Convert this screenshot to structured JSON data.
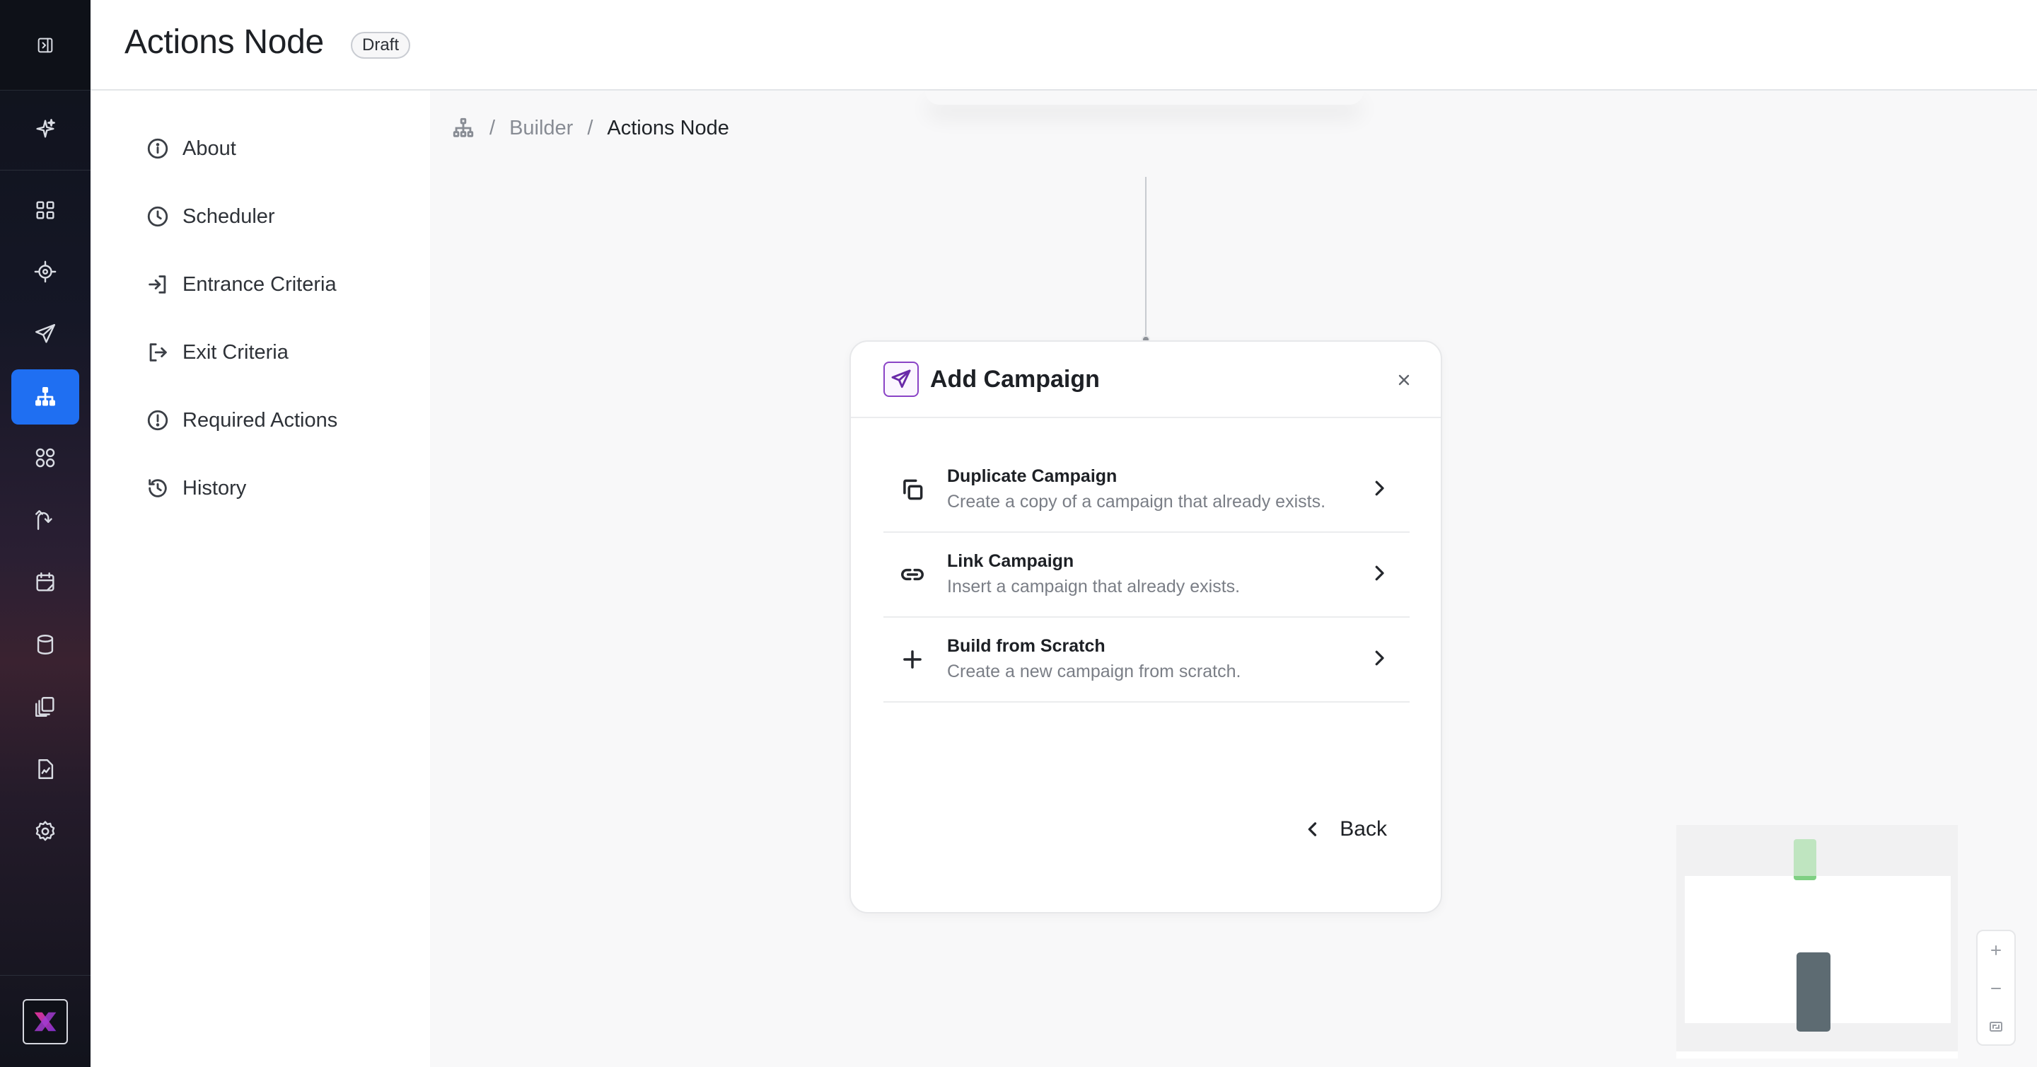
{
  "header": {
    "title": "Actions Node",
    "status_badge": "Draft"
  },
  "rail": {
    "items": [
      {
        "icon": "sidebar-expand-icon"
      },
      {
        "icon": "sparkle-icon"
      },
      {
        "icon": "dashboard-grid-icon"
      },
      {
        "icon": "target-icon"
      },
      {
        "icon": "send-icon"
      },
      {
        "icon": "hierarchy-icon",
        "active": true
      },
      {
        "icon": "shapes-icon"
      },
      {
        "icon": "journey-icon"
      },
      {
        "icon": "calendar-icon"
      },
      {
        "icon": "database-icon"
      },
      {
        "icon": "library-icon"
      },
      {
        "icon": "report-icon"
      },
      {
        "icon": "settings-icon"
      }
    ],
    "logo": "brand-x-logo",
    "active_color": "#1f6ff2"
  },
  "subnav": {
    "items": [
      {
        "label": "About",
        "icon": "info-icon"
      },
      {
        "label": "Scheduler",
        "icon": "clock-icon"
      },
      {
        "label": "Entrance Criteria",
        "icon": "login-icon"
      },
      {
        "label": "Exit Criteria",
        "icon": "logout-icon"
      },
      {
        "label": "Required Actions",
        "icon": "alert-circle-icon"
      },
      {
        "label": "History",
        "icon": "history-icon"
      }
    ]
  },
  "breadcrumb": {
    "items": [
      "Builder",
      "Actions Node"
    ],
    "root_icon": "hierarchy-icon",
    "separator": "/"
  },
  "modal": {
    "title": "Add Campaign",
    "icon": "send-icon",
    "accent": "#8a43c6",
    "options": [
      {
        "title": "Duplicate Campaign",
        "description": "Create a copy of a campaign that already exists.",
        "icon": "copy-icon"
      },
      {
        "title": "Link Campaign",
        "description": "Insert a campaign that already exists.",
        "icon": "link-icon"
      },
      {
        "title": "Build from Scratch",
        "description": "Create a new campaign from scratch.",
        "icon": "plus-icon"
      }
    ],
    "back_label": "Back"
  },
  "minimap": {
    "node_colors": [
      "#bfe5c0",
      "#5d6b72"
    ]
  },
  "zoom_controls": {
    "icons": [
      "zoom-in-icon",
      "zoom-out-icon",
      "fit-view-icon"
    ]
  }
}
